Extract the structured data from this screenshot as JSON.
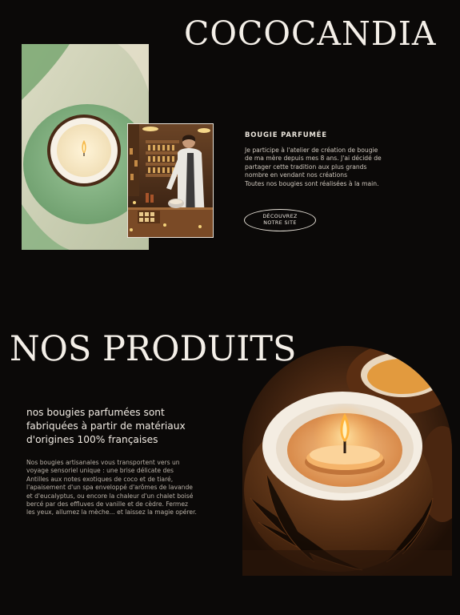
{
  "brand": {
    "title": "COCOCANDIA"
  },
  "intro": {
    "heading": "BOUGIE PARFUMÉE",
    "lines": [
      "Je participe à l'atelier de création de bougie",
      "de ma mère depuis mes 8 ans. J'ai décidé de",
      "partager cette tradition aux plus grands",
      "nombre en vendant nos créations",
      "Toutes nos bougies sont réalisées à la main."
    ],
    "cta_line1": "DÉCOUVREZ",
    "cta_line2": "NOTRE SITE"
  },
  "products": {
    "title": "NOS PRODUITS",
    "lead": [
      "nos bougies parfumées sont",
      "fabriquées à partir de matériaux",
      "d'origines 100% françaises"
    ],
    "body": [
      "Nos bougies artisanales vous transportent vers un",
      "voyage sensoriel unique : une brise délicate des",
      "Antilles aux notes exotiques de coco et de tiaré,",
      "l'apaisement d'un spa enveloppé d'arômes de lavande",
      "et d'eucalyptus, ou encore la chaleur d'un chalet boisé",
      "bercé par des effluves de vanille et de cèdre. Fermez",
      "les yeux, allumez la mèche... et laissez la magie opérer."
    ]
  },
  "colors": {
    "background": "#0b0908",
    "text": "#efe9e1",
    "sage_green": "#8fb88a",
    "coconut_brown": "#5a3318"
  }
}
